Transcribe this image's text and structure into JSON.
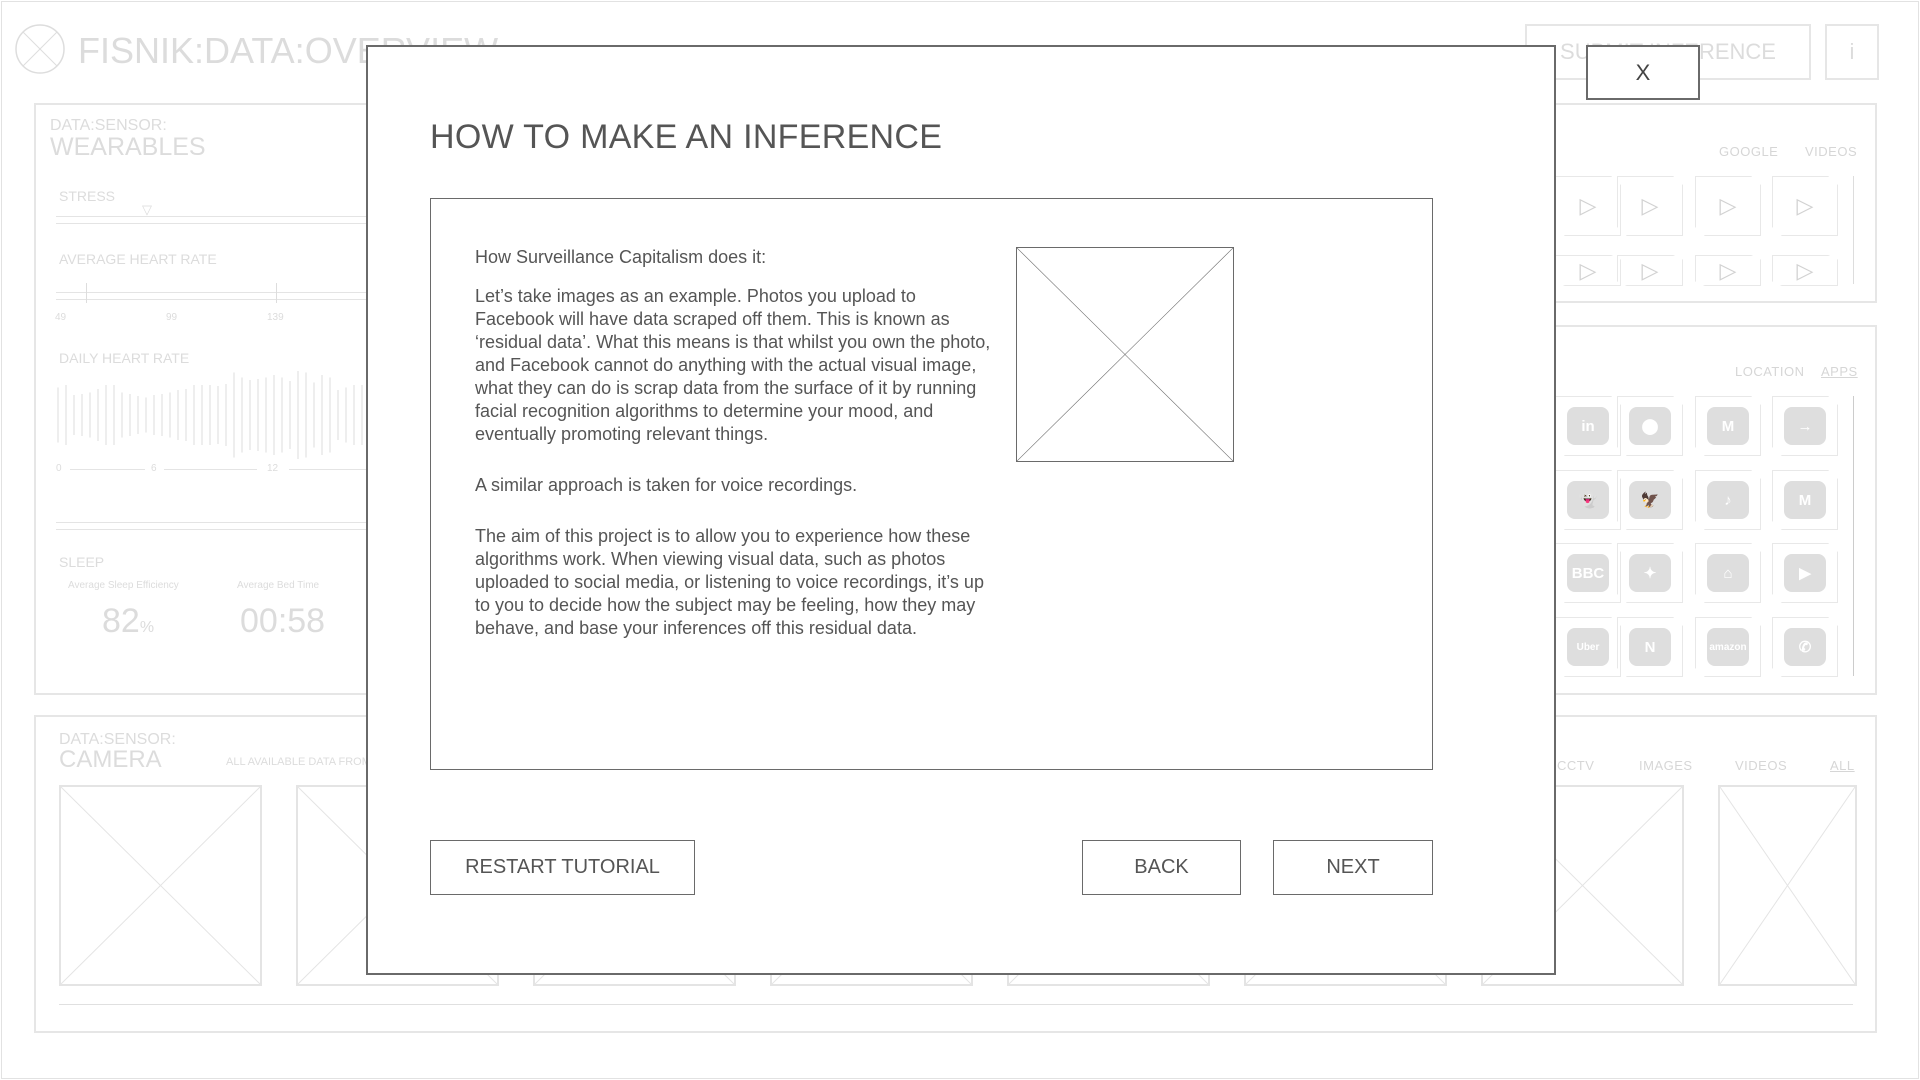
{
  "background": {
    "app_title": "FISNIK:DATA:OVERVIEW",
    "submit_button": "SUBMIT INFERENCE",
    "info_button": "i",
    "wearables": {
      "kicker": "DATA:SENSOR:",
      "title": "WEARABLES",
      "stress_label": "STRESS",
      "avg_hr_label": "AVERAGE HEART RATE",
      "avg_hr_ticks": [
        "49",
        "99",
        "139"
      ],
      "daily_hr_label": "DAILY HEART RATE",
      "daily_hr_ticks": [
        "0",
        "6",
        "12"
      ],
      "daily_hr_bars": [
        0.55,
        0.6,
        0.4,
        0.42,
        0.45,
        0.52,
        0.6,
        0.6,
        0.45,
        0.42,
        0.38,
        0.35,
        0.4,
        0.42,
        0.45,
        0.5,
        0.52,
        0.6,
        0.6,
        0.6,
        0.58,
        0.62,
        0.85,
        0.75,
        0.7,
        0.72,
        0.75,
        0.8,
        0.75,
        0.68,
        0.88,
        0.85,
        0.65,
        0.8,
        0.75,
        0.5,
        0.55,
        0.6,
        0.6
      ],
      "sleep_label": "SLEEP",
      "sleep_efficiency_label": "Average Sleep Efficiency",
      "sleep_efficiency_value": "82",
      "sleep_efficiency_unit": "%",
      "bed_time_label": "Average Bed Time",
      "bed_time_value": "00:58"
    },
    "videos_panel": {
      "tabs": [
        "GOOGLE",
        "VIDEOS"
      ]
    },
    "apps_panel": {
      "tabs": [
        "LOCATION",
        "APPS"
      ],
      "apps": [
        {
          "name": "linkedin",
          "glyph": "in"
        },
        {
          "name": "google-maps",
          "glyph": "⬤"
        },
        {
          "name": "gmail",
          "glyph": "M"
        },
        {
          "name": "arrow-app",
          "glyph": "→"
        },
        {
          "name": "snapchat",
          "glyph": "👻"
        },
        {
          "name": "barclays",
          "glyph": "🦅"
        },
        {
          "name": "tiktok",
          "glyph": "♪"
        },
        {
          "name": "gmail",
          "glyph": "M"
        },
        {
          "name": "bbc-news",
          "glyph": "BBC"
        },
        {
          "name": "google-photos",
          "glyph": "✦"
        },
        {
          "name": "google-home",
          "glyph": "⌂"
        },
        {
          "name": "youtube",
          "glyph": "▶"
        },
        {
          "name": "uber",
          "glyph": "Uber"
        },
        {
          "name": "netflix",
          "glyph": "N"
        },
        {
          "name": "amazon",
          "glyph": "amazon"
        },
        {
          "name": "whatsapp",
          "glyph": "✆"
        }
      ]
    },
    "camera": {
      "kicker": "DATA:SENSOR:",
      "title": "CAMERA",
      "subtitle": "ALL AVAILABLE DATA FROM",
      "tabs": [
        "CCTV",
        "IMAGES",
        "VIDEOS",
        "ALL"
      ]
    }
  },
  "modal": {
    "close_label": "X",
    "title": "HOW TO MAKE AN INFERENCE",
    "paragraphs": [
      "How Surveillance Capitalism does it:",
      "Let’s take images as an example. Photos you upload to Facebook will have data scraped off them. This is known as ‘residual data’. What this means is that whilst you own the photo, and Facebook cannot do anything with the actual visual image, what they can do is scrap data from the surface of it by running facial recognition algorithms to determine your mood, and eventually promoting relevant things.",
      "A similar approach is taken for voice recordings.",
      "The aim of this project is to allow you to experience how these algorithms work. When viewing visual data, such as photos uploaded to social media, or listening to voice recordings, it’s up to you to decide how the subject may be feeling, how they may behave, and base your inferences off this residual data."
    ],
    "restart_label": "RESTART TUTORIAL",
    "back_label": "BACK",
    "next_label": "NEXT"
  }
}
